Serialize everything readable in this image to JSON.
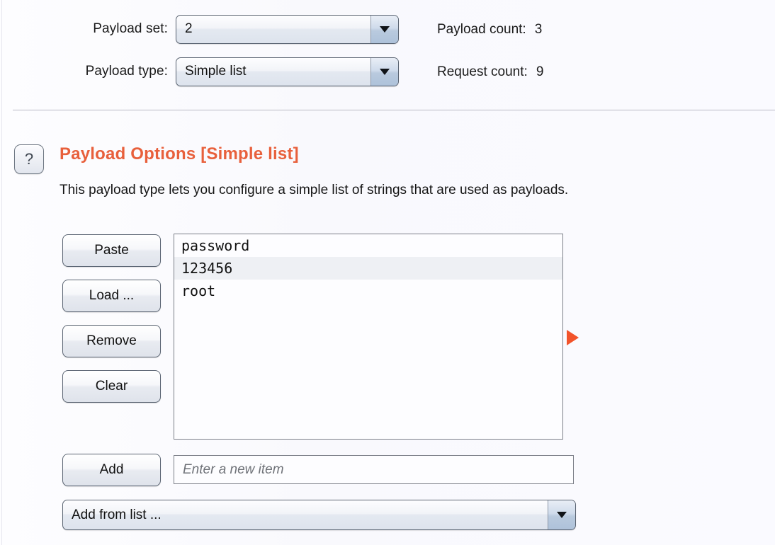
{
  "config": {
    "payload_set": {
      "label": "Payload set:",
      "value": "2"
    },
    "payload_type": {
      "label": "Payload type:",
      "value": "Simple list"
    },
    "payload_count": {
      "label": "Payload count:",
      "value": "3"
    },
    "request_count": {
      "label": "Request count:",
      "value": "9"
    }
  },
  "section": {
    "help_glyph": "?",
    "title": "Payload Options [Simple list]",
    "description": "This payload type lets you configure a simple list of strings that are used as payloads."
  },
  "buttons": {
    "paste": "Paste",
    "load": "Load ...",
    "remove": "Remove",
    "clear": "Clear",
    "add": "Add"
  },
  "payload_list": {
    "items": [
      "password",
      "123456",
      "root"
    ]
  },
  "new_item_input": {
    "value": "",
    "placeholder": "Enter a new item"
  },
  "add_from_list": {
    "value": "Add from list ..."
  },
  "colors": {
    "accent": "#e8603c",
    "marker": "#f2532a",
    "background": "#fafaff",
    "border": "#7b7f88"
  }
}
